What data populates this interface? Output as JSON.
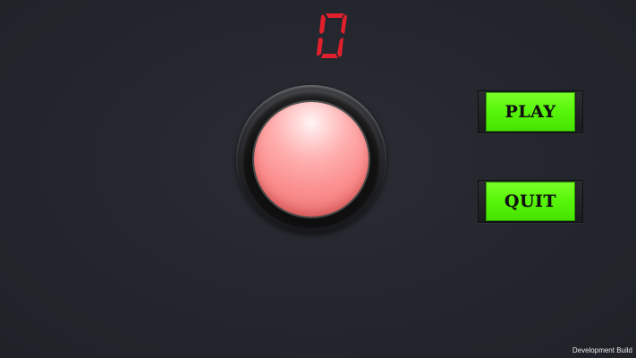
{
  "score": {
    "value": "0",
    "color": "#e0202c"
  },
  "main_button": {
    "color": "#f58a8a"
  },
  "menu": {
    "play_label": "PLAY",
    "quit_label": "QUIT",
    "button_color": "#55f50a"
  },
  "footer": {
    "build_text": "Development Build"
  }
}
